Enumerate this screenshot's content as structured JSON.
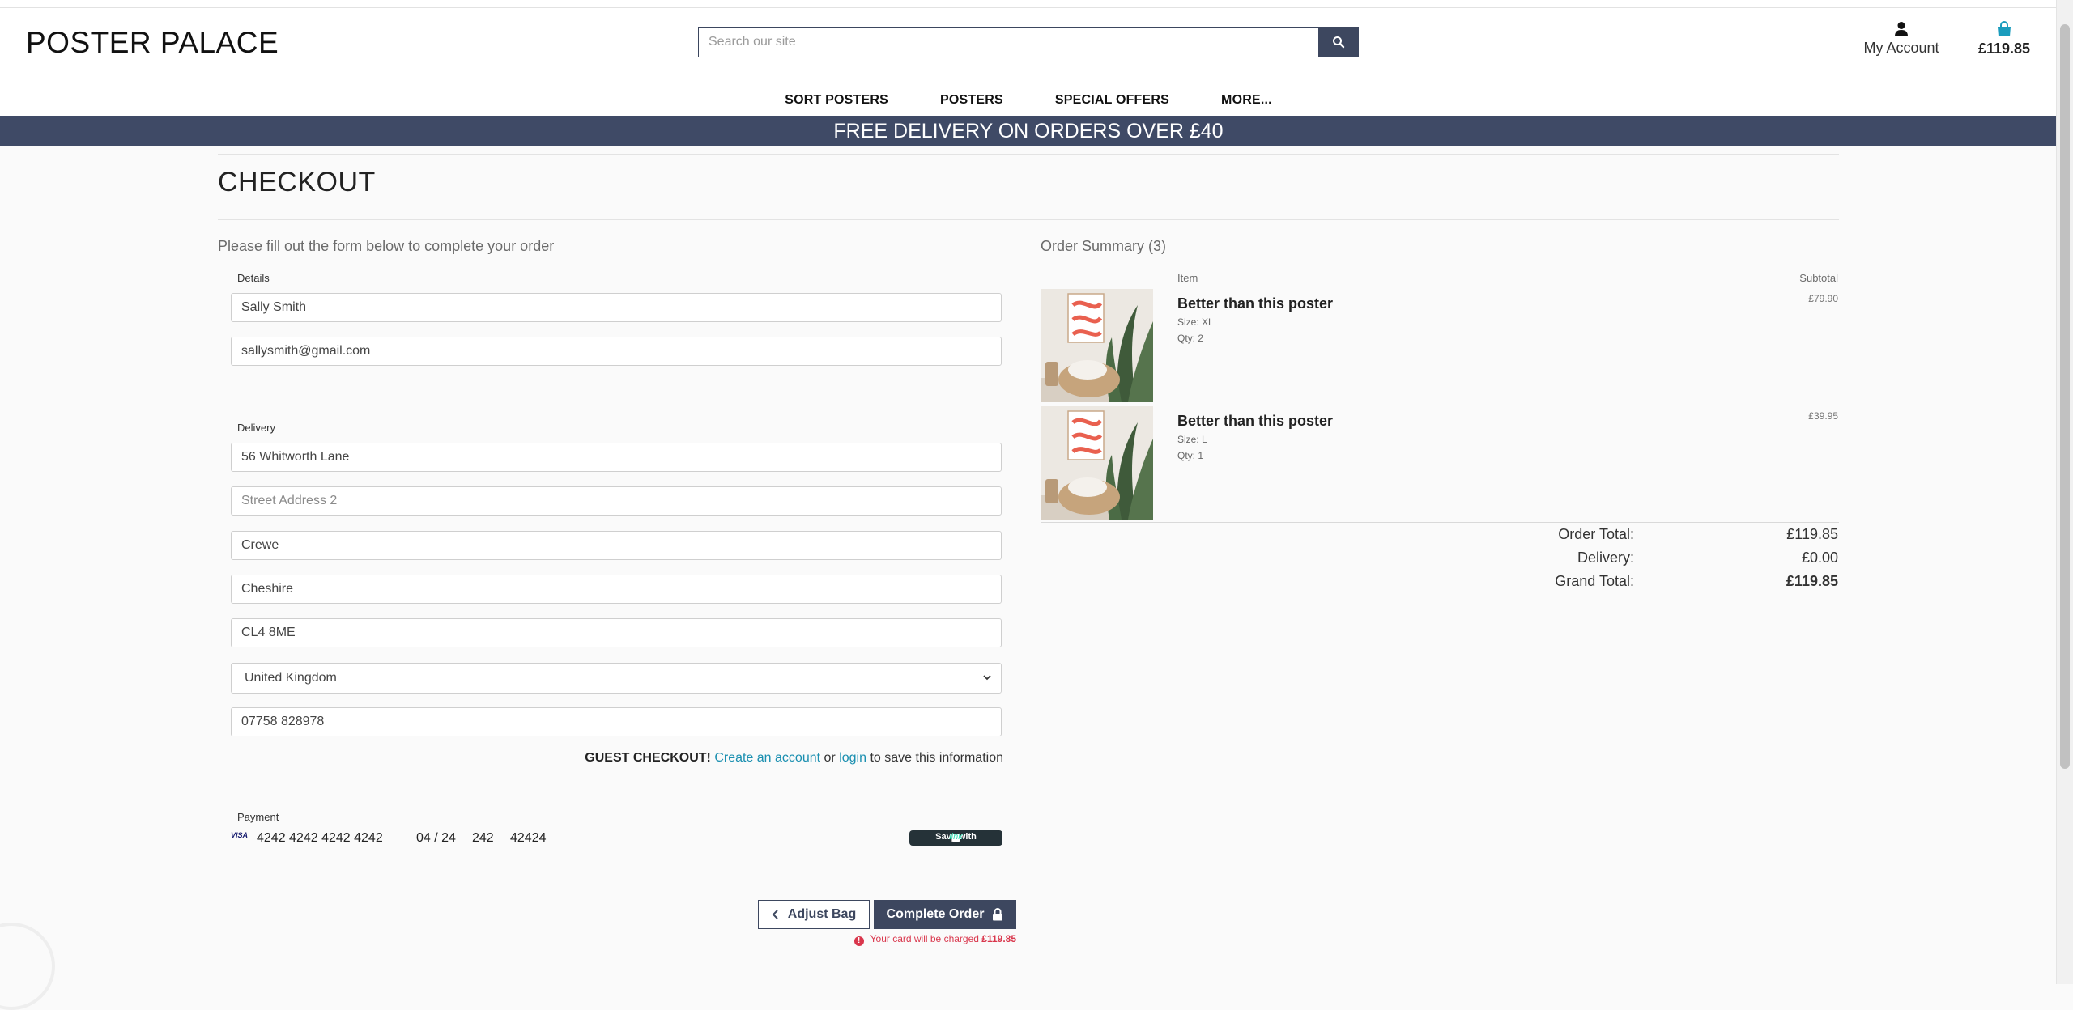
{
  "header": {
    "logo_bold": "POSTER",
    "logo_light": "PALACE",
    "search_placeholder": "Search our site",
    "account_label": "My Account",
    "bag_total": "£119.85"
  },
  "nav": [
    "SORT POSTERS",
    "POSTERS",
    "SPECIAL OFFERS",
    "MORE..."
  ],
  "banner": "FREE DELIVERY ON ORDERS OVER £40",
  "page": {
    "title": "CHECKOUT",
    "intro": "Please fill out the form below to complete your order"
  },
  "form": {
    "details_label": "Details",
    "full_name": "Sally Smith",
    "email": "sallysmith@gmail.com",
    "delivery_label": "Delivery",
    "street1": "56 Whitworth Lane",
    "street2_placeholder": "Street Address 2",
    "town": "Crewe",
    "county": "Cheshire",
    "postcode": "CL4 8ME",
    "country": "United Kingdom",
    "phone": "07758 828978",
    "guest_bold": "GUEST CHECKOUT!",
    "guest_create": "Create an account",
    "guest_or": "or",
    "guest_login": "login",
    "guest_tail": "to save this information",
    "payment_label": "Payment",
    "card_brand": "VISA",
    "card_number": "4242 4242 4242 4242",
    "card_expiry": "04 / 24",
    "card_cvc": "242",
    "card_postcode": "42424",
    "save_with": "Save with",
    "link_brand": "link"
  },
  "actions": {
    "adjust_bag": "Adjust Bag",
    "complete_order": "Complete Order",
    "charge_text": "Your card will be charged",
    "charge_amount": "£119.85"
  },
  "summary": {
    "title": "Order Summary (3)",
    "col_item": "Item",
    "col_subtotal": "Subtotal",
    "items": [
      {
        "name": "Better than this poster",
        "size": "Size: XL",
        "qty": "Qty: 2",
        "subtotal": "£79.90"
      },
      {
        "name": "Better than this poster",
        "size": "Size: L",
        "qty": "Qty: 1",
        "subtotal": "£39.95"
      }
    ],
    "order_total_label": "Order Total:",
    "order_total": "£119.85",
    "delivery_label": "Delivery:",
    "delivery": "£0.00",
    "grand_total_label": "Grand Total:",
    "grand_total": "£119.85"
  },
  "colors": {
    "brand_navy": "#3d475f",
    "banner": "#3f4a66",
    "link": "#1a8fb0",
    "error": "#d9364c"
  }
}
